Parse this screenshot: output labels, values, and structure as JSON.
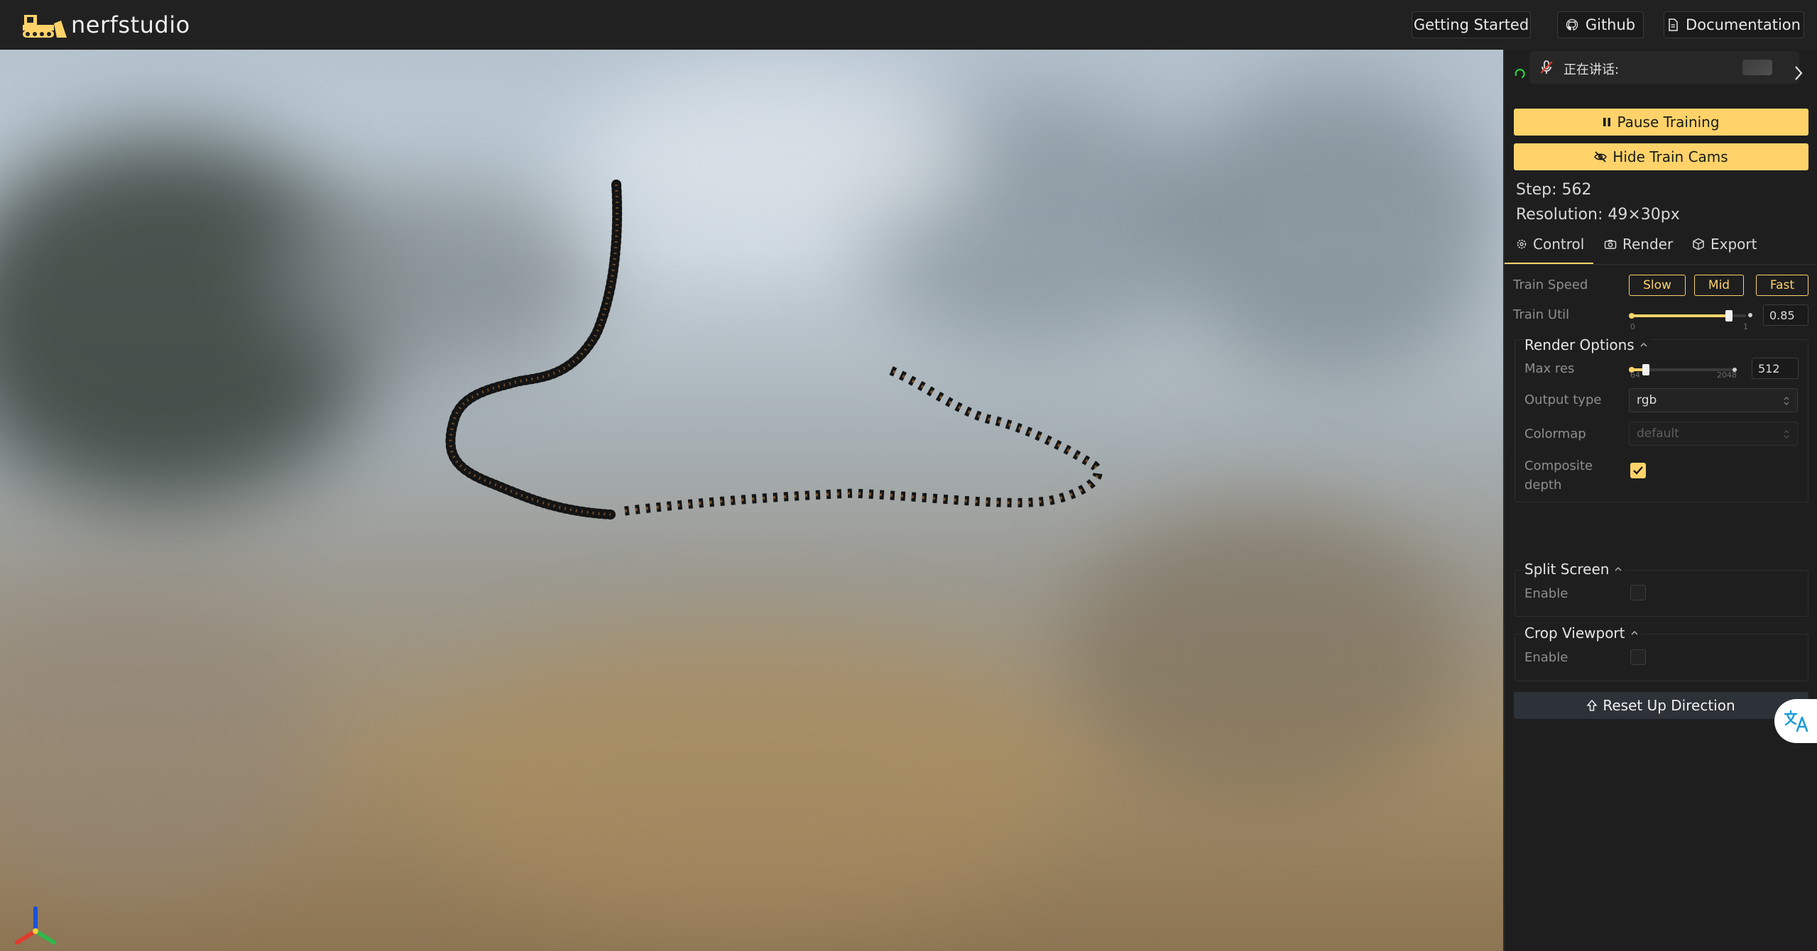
{
  "header": {
    "logo_text": "nerfstudio",
    "buttons": [
      {
        "label": "Getting Started"
      },
      {
        "label": "Github",
        "icon": "github-icon"
      },
      {
        "label": "Documentation",
        "icon": "document-icon"
      }
    ]
  },
  "voice_widget": {
    "label": "正在讲话:"
  },
  "panel": {
    "pause_label": "Pause Training",
    "hide_cams_label": "Hide Train Cams",
    "step": "Step: 562",
    "resolution": "Resolution: 49×30px",
    "tabs": [
      {
        "label": "Control",
        "icon": "gear-icon",
        "active": true
      },
      {
        "label": "Render",
        "icon": "camera-icon"
      },
      {
        "label": "Export",
        "icon": "package-icon"
      }
    ],
    "train_speed": {
      "label": "Train Speed",
      "options": [
        "Slow",
        "Mid",
        "Fast"
      ]
    },
    "train_util": {
      "label": "Train Util",
      "min": "0",
      "max": "1",
      "value": "0.85",
      "fraction": 0.85
    },
    "render_options": {
      "title": "Render Options",
      "max_res": {
        "label": "Max res",
        "min": "64",
        "max": "2048",
        "value": "512",
        "fraction": 0.15
      },
      "output_type": {
        "label": "Output type",
        "value": "rgb"
      },
      "colormap": {
        "label": "Colormap",
        "value": "default"
      },
      "composite_depth": {
        "label_line1": "Composite",
        "label_line2": "depth",
        "checked": true
      }
    },
    "split_screen": {
      "title": "Split Screen",
      "enable_label": "Enable",
      "checked": false
    },
    "crop_viewport": {
      "title": "Crop Viewport",
      "enable_label": "Enable",
      "checked": false
    },
    "reset_label": "Reset Up Direction"
  },
  "colors": {
    "accent": "#ffd369",
    "navbar": "#212121",
    "panel": "#1e1e1e"
  }
}
